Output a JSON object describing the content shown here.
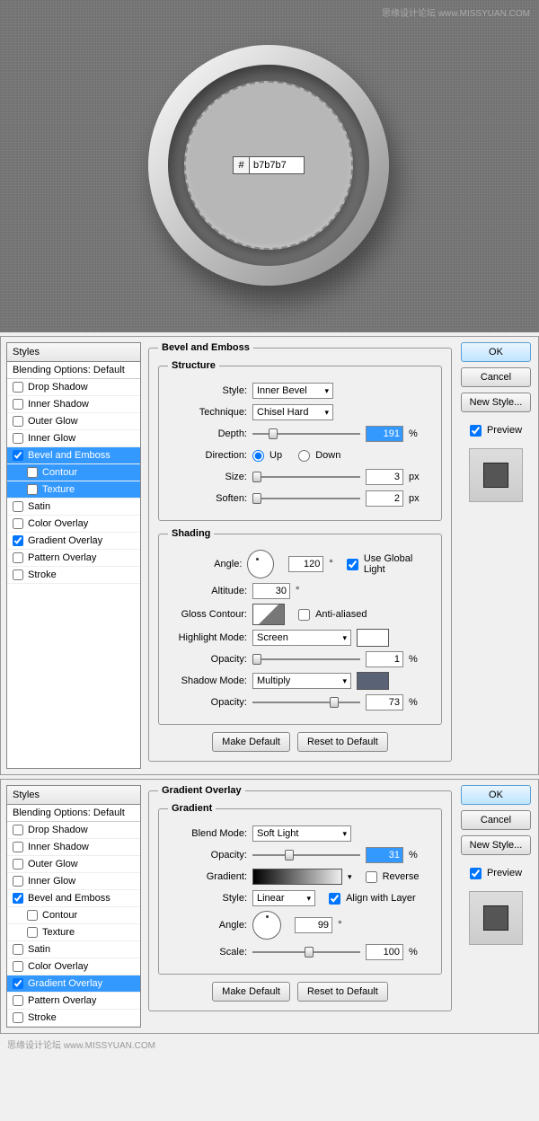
{
  "watermark": "思缘设计论坛 www.MISSYUAN.COM",
  "hex_prefix": "#",
  "hex_value": "b7b7b7",
  "styles_header": "Styles",
  "blending_default": "Blending Options: Default",
  "style_items": [
    "Drop Shadow",
    "Inner Shadow",
    "Outer Glow",
    "Inner Glow",
    "Bevel and Emboss",
    "Contour",
    "Texture",
    "Satin",
    "Color Overlay",
    "Gradient Overlay",
    "Pattern Overlay",
    "Stroke"
  ],
  "buttons": {
    "ok": "OK",
    "cancel": "Cancel",
    "new_style": "New Style...",
    "preview": "Preview",
    "make_default": "Make Default",
    "reset_default": "Reset to Default"
  },
  "panel1": {
    "title": "Bevel and Emboss",
    "structure": "Structure",
    "style_lbl": "Style:",
    "style_val": "Inner Bevel",
    "technique_lbl": "Technique:",
    "technique_val": "Chisel Hard",
    "depth_lbl": "Depth:",
    "depth_val": "191",
    "depth_unit": "%",
    "direction_lbl": "Direction:",
    "up": "Up",
    "down": "Down",
    "size_lbl": "Size:",
    "size_val": "3",
    "size_unit": "px",
    "soften_lbl": "Soften:",
    "soften_val": "2",
    "soften_unit": "px",
    "shading": "Shading",
    "angle_lbl": "Angle:",
    "angle_val": "120",
    "angle_unit": "°",
    "global_light": "Use Global Light",
    "altitude_lbl": "Altitude:",
    "altitude_val": "30",
    "altitude_unit": "°",
    "gloss_lbl": "Gloss Contour:",
    "anti": "Anti-aliased",
    "hlmode_lbl": "Highlight Mode:",
    "hlmode_val": "Screen",
    "hl_opacity_lbl": "Opacity:",
    "hl_opacity_val": "1",
    "hl_unit": "%",
    "shmode_lbl": "Shadow Mode:",
    "shmode_val": "Multiply",
    "sh_opacity_lbl": "Opacity:",
    "sh_opacity_val": "73",
    "sh_unit": "%",
    "shadow_color": "#5a6376"
  },
  "panel2": {
    "title": "Gradient Overlay",
    "gradient": "Gradient",
    "blend_lbl": "Blend Mode:",
    "blend_val": "Soft Light",
    "opacity_lbl": "Opacity:",
    "opacity_val": "31",
    "opacity_unit": "%",
    "gradient_lbl": "Gradient:",
    "reverse": "Reverse",
    "style_lbl": "Style:",
    "style_val": "Linear",
    "align": "Align with Layer",
    "angle_lbl": "Angle:",
    "angle_val": "99",
    "angle_unit": "°",
    "scale_lbl": "Scale:",
    "scale_val": "100",
    "scale_unit": "%"
  }
}
